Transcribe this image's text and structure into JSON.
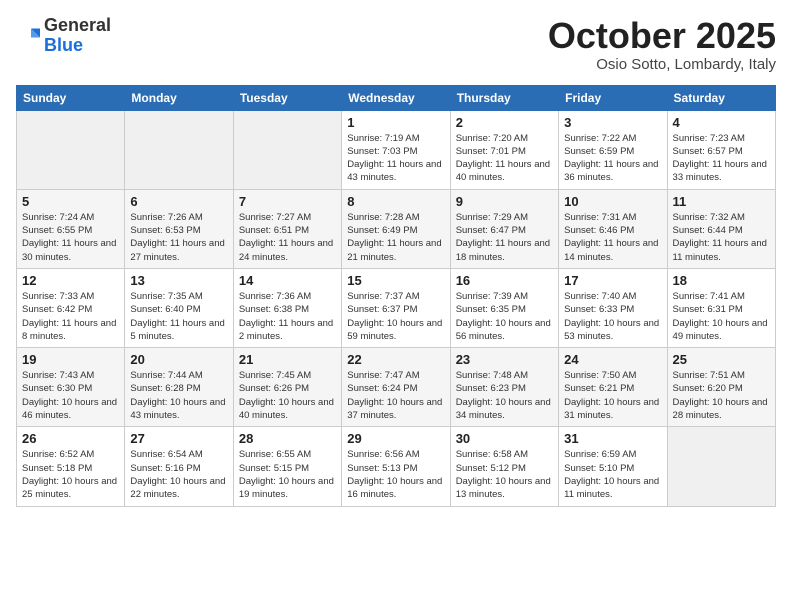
{
  "header": {
    "logo_general": "General",
    "logo_blue": "Blue",
    "month_title": "October 2025",
    "location": "Osio Sotto, Lombardy, Italy"
  },
  "weekdays": [
    "Sunday",
    "Monday",
    "Tuesday",
    "Wednesday",
    "Thursday",
    "Friday",
    "Saturday"
  ],
  "weeks": [
    [
      {
        "num": "",
        "info": ""
      },
      {
        "num": "",
        "info": ""
      },
      {
        "num": "",
        "info": ""
      },
      {
        "num": "1",
        "info": "Sunrise: 7:19 AM\nSunset: 7:03 PM\nDaylight: 11 hours and 43 minutes."
      },
      {
        "num": "2",
        "info": "Sunrise: 7:20 AM\nSunset: 7:01 PM\nDaylight: 11 hours and 40 minutes."
      },
      {
        "num": "3",
        "info": "Sunrise: 7:22 AM\nSunset: 6:59 PM\nDaylight: 11 hours and 36 minutes."
      },
      {
        "num": "4",
        "info": "Sunrise: 7:23 AM\nSunset: 6:57 PM\nDaylight: 11 hours and 33 minutes."
      }
    ],
    [
      {
        "num": "5",
        "info": "Sunrise: 7:24 AM\nSunset: 6:55 PM\nDaylight: 11 hours and 30 minutes."
      },
      {
        "num": "6",
        "info": "Sunrise: 7:26 AM\nSunset: 6:53 PM\nDaylight: 11 hours and 27 minutes."
      },
      {
        "num": "7",
        "info": "Sunrise: 7:27 AM\nSunset: 6:51 PM\nDaylight: 11 hours and 24 minutes."
      },
      {
        "num": "8",
        "info": "Sunrise: 7:28 AM\nSunset: 6:49 PM\nDaylight: 11 hours and 21 minutes."
      },
      {
        "num": "9",
        "info": "Sunrise: 7:29 AM\nSunset: 6:47 PM\nDaylight: 11 hours and 18 minutes."
      },
      {
        "num": "10",
        "info": "Sunrise: 7:31 AM\nSunset: 6:46 PM\nDaylight: 11 hours and 14 minutes."
      },
      {
        "num": "11",
        "info": "Sunrise: 7:32 AM\nSunset: 6:44 PM\nDaylight: 11 hours and 11 minutes."
      }
    ],
    [
      {
        "num": "12",
        "info": "Sunrise: 7:33 AM\nSunset: 6:42 PM\nDaylight: 11 hours and 8 minutes."
      },
      {
        "num": "13",
        "info": "Sunrise: 7:35 AM\nSunset: 6:40 PM\nDaylight: 11 hours and 5 minutes."
      },
      {
        "num": "14",
        "info": "Sunrise: 7:36 AM\nSunset: 6:38 PM\nDaylight: 11 hours and 2 minutes."
      },
      {
        "num": "15",
        "info": "Sunrise: 7:37 AM\nSunset: 6:37 PM\nDaylight: 10 hours and 59 minutes."
      },
      {
        "num": "16",
        "info": "Sunrise: 7:39 AM\nSunset: 6:35 PM\nDaylight: 10 hours and 56 minutes."
      },
      {
        "num": "17",
        "info": "Sunrise: 7:40 AM\nSunset: 6:33 PM\nDaylight: 10 hours and 53 minutes."
      },
      {
        "num": "18",
        "info": "Sunrise: 7:41 AM\nSunset: 6:31 PM\nDaylight: 10 hours and 49 minutes."
      }
    ],
    [
      {
        "num": "19",
        "info": "Sunrise: 7:43 AM\nSunset: 6:30 PM\nDaylight: 10 hours and 46 minutes."
      },
      {
        "num": "20",
        "info": "Sunrise: 7:44 AM\nSunset: 6:28 PM\nDaylight: 10 hours and 43 minutes."
      },
      {
        "num": "21",
        "info": "Sunrise: 7:45 AM\nSunset: 6:26 PM\nDaylight: 10 hours and 40 minutes."
      },
      {
        "num": "22",
        "info": "Sunrise: 7:47 AM\nSunset: 6:24 PM\nDaylight: 10 hours and 37 minutes."
      },
      {
        "num": "23",
        "info": "Sunrise: 7:48 AM\nSunset: 6:23 PM\nDaylight: 10 hours and 34 minutes."
      },
      {
        "num": "24",
        "info": "Sunrise: 7:50 AM\nSunset: 6:21 PM\nDaylight: 10 hours and 31 minutes."
      },
      {
        "num": "25",
        "info": "Sunrise: 7:51 AM\nSunset: 6:20 PM\nDaylight: 10 hours and 28 minutes."
      }
    ],
    [
      {
        "num": "26",
        "info": "Sunrise: 6:52 AM\nSunset: 5:18 PM\nDaylight: 10 hours and 25 minutes."
      },
      {
        "num": "27",
        "info": "Sunrise: 6:54 AM\nSunset: 5:16 PM\nDaylight: 10 hours and 22 minutes."
      },
      {
        "num": "28",
        "info": "Sunrise: 6:55 AM\nSunset: 5:15 PM\nDaylight: 10 hours and 19 minutes."
      },
      {
        "num": "29",
        "info": "Sunrise: 6:56 AM\nSunset: 5:13 PM\nDaylight: 10 hours and 16 minutes."
      },
      {
        "num": "30",
        "info": "Sunrise: 6:58 AM\nSunset: 5:12 PM\nDaylight: 10 hours and 13 minutes."
      },
      {
        "num": "31",
        "info": "Sunrise: 6:59 AM\nSunset: 5:10 PM\nDaylight: 10 hours and 11 minutes."
      },
      {
        "num": "",
        "info": ""
      }
    ]
  ]
}
